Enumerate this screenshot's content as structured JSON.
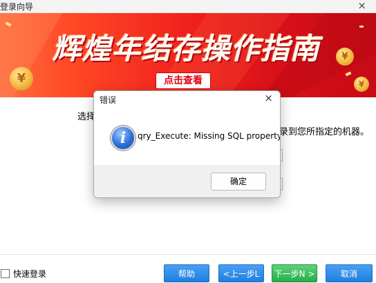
{
  "window": {
    "title": "登录向导",
    "close_glyph": "×"
  },
  "banner": {
    "headline": "辉煌年结存操作指南",
    "cta": "点击查看",
    "coin_glyph": "¥"
  },
  "wizard": {
    "text_left": "选择",
    "text_right": "录到您所指定的机器。",
    "quick_login_label": "快速登录",
    "buttons": {
      "help": "帮助",
      "prev": "<上一步L",
      "next": "下一步N >",
      "cancel": "取消"
    }
  },
  "error_dialog": {
    "title": "错误",
    "close_glyph": "×",
    "icon_glyph": "i",
    "message": "qry_Execute: Missing SQL property",
    "ok_label": "确定"
  },
  "colors": {
    "banner_red": "#e41a1e",
    "button_blue": "#2a86e6",
    "button_green": "#31b452"
  }
}
